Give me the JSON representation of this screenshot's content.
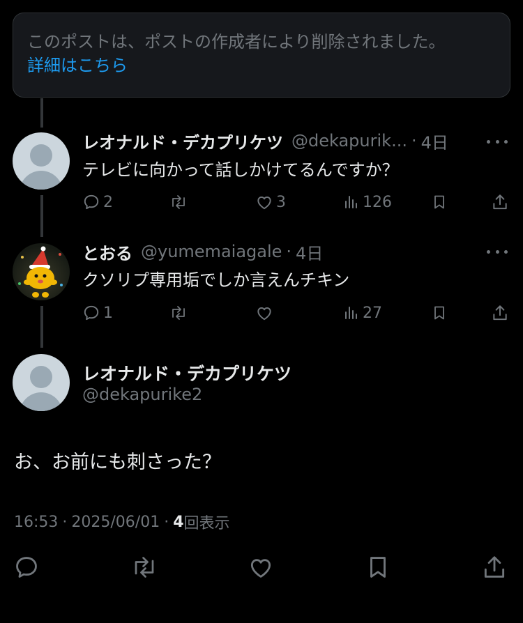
{
  "deleted_notice": {
    "text": "このポストは、ポストの作成者により削除されました。",
    "link": "詳細はこちら"
  },
  "replies": [
    {
      "display_name": "レオナルド・デカプリケツ",
      "handle": "@dekapurik...",
      "separator": "·",
      "time": "4日",
      "text": "テレビに向かって話しかけてるんですか？",
      "reply_count": "2",
      "repost_count": "",
      "like_count": "3",
      "view_count": "126",
      "avatar": "default-avatar"
    },
    {
      "display_name": "とおる",
      "handle": "@yumemaiagale",
      "separator": "·",
      "time": "4日",
      "text": "クソリプ専用垢でしか言えんチキン",
      "reply_count": "1",
      "repost_count": "",
      "like_count": "",
      "view_count": "27",
      "avatar": "photo-avatar"
    }
  ],
  "main_post": {
    "display_name": "レオナルド・デカプリケツ",
    "handle": "@dekapurike2",
    "text": "お、お前にも刺さった？",
    "time": "16:53",
    "date": "2025/06/01",
    "separator": "·",
    "views_count": "4",
    "views_label": "回表示"
  },
  "icons": [
    "more-icon",
    "reply-icon",
    "repost-icon",
    "like-icon",
    "views-icon",
    "bookmark-icon",
    "share-icon"
  ],
  "colors": {
    "background": "#000000",
    "text_primary": "#e7e9ea",
    "text_secondary": "#71767b",
    "link": "#1d9bf0",
    "card": "#16181c",
    "thread_line": "#333639"
  }
}
